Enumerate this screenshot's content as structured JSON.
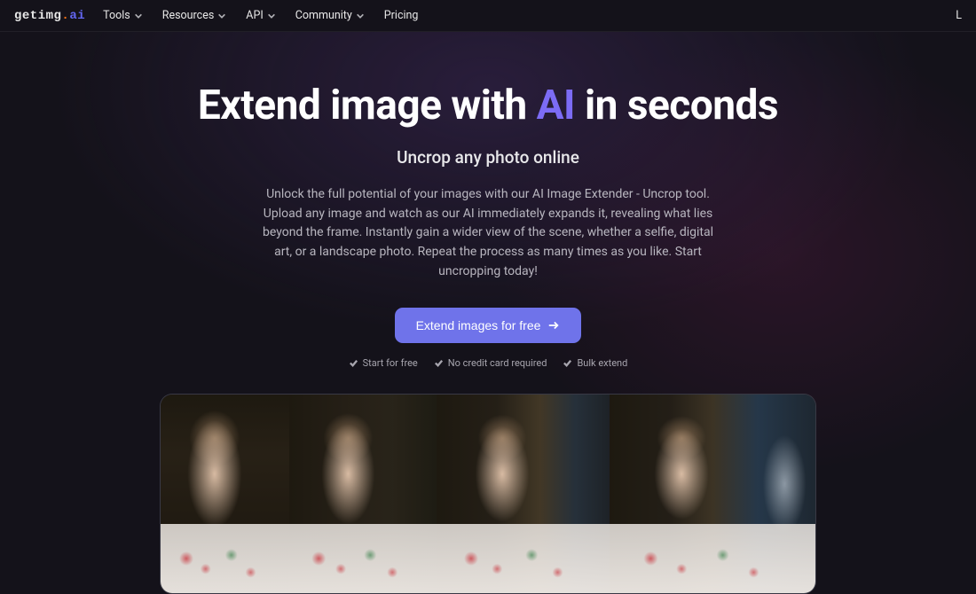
{
  "brand": {
    "name1": "getimg",
    "dot": ".",
    "name2": "ai"
  },
  "nav": {
    "items": [
      {
        "label": "Tools",
        "dropdown": true
      },
      {
        "label": "Resources",
        "dropdown": true
      },
      {
        "label": "API",
        "dropdown": true
      },
      {
        "label": "Community",
        "dropdown": true
      },
      {
        "label": "Pricing",
        "dropdown": false
      }
    ],
    "right": "L"
  },
  "hero": {
    "title_pre": "Extend image with ",
    "title_highlight": "AI",
    "title_post": " in seconds",
    "subtitle": "Uncrop any photo online",
    "description": "Unlock the full potential of your images with our AI Image Extender - Uncrop tool. Upload any image and watch as our AI immediately expands it, revealing what lies beyond the frame. Instantly gain a wider view of the scene, whether a selfie, digital art, or a landscape photo. Repeat the process as many times as you like. Start uncropping today!",
    "cta": "Extend images for free",
    "features": [
      "Start for free",
      "No credit card required",
      "Bulk extend"
    ]
  }
}
